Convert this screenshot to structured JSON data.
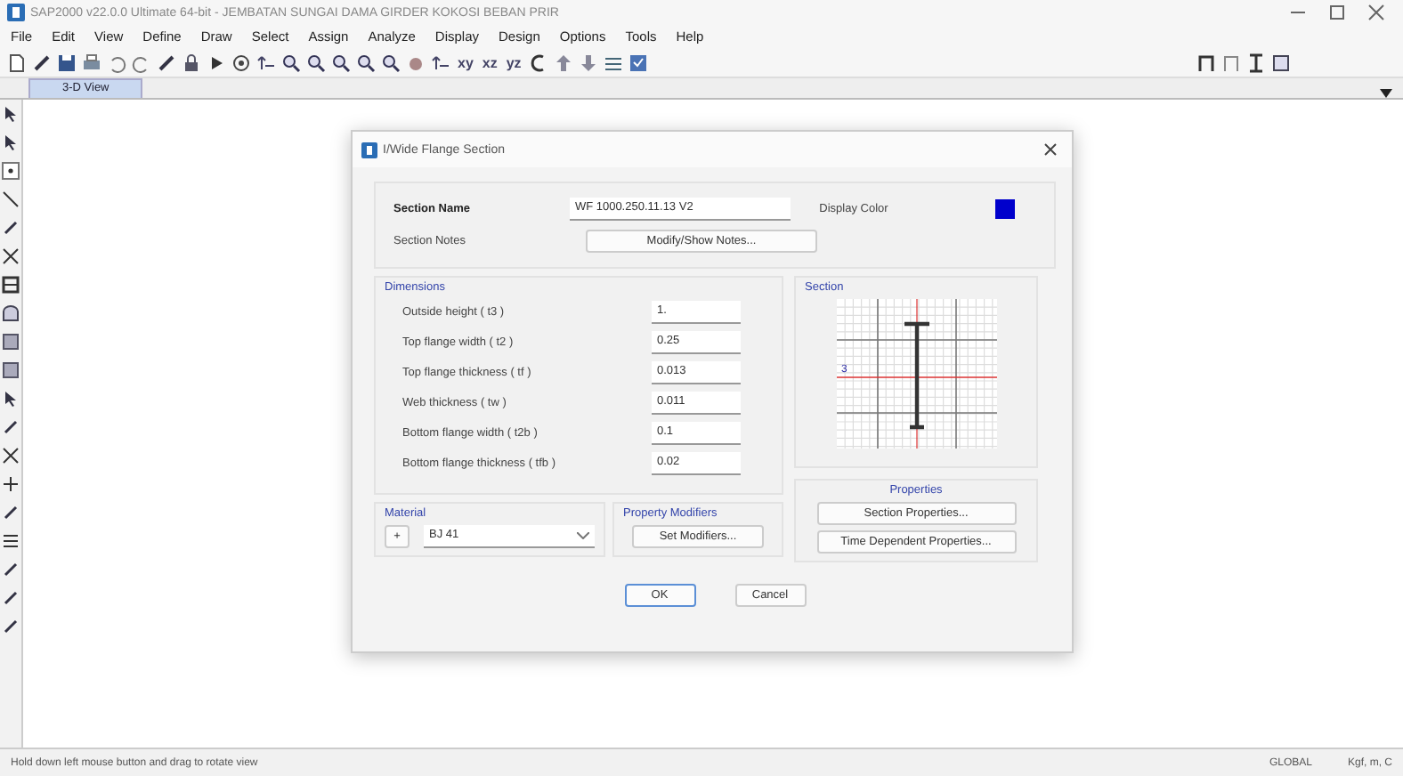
{
  "window": {
    "title": "SAP2000 v22.0.0 Ultimate 64-bit - JEMBATAN SUNGAI DAMA GIRDER KOKOSI BEBAN PRIR"
  },
  "menu": [
    "File",
    "Edit",
    "View",
    "Define",
    "Draw",
    "Select",
    "Assign",
    "Analyze",
    "Display",
    "Design",
    "Options",
    "Tools",
    "Help"
  ],
  "view_plane_buttons": [
    "xy",
    "xz",
    "yz"
  ],
  "tabs": [
    {
      "label": "3-D View",
      "selected": true
    }
  ],
  "dialog": {
    "title": "I/Wide Flange Section",
    "section_name_label": "Section Name",
    "section_name": "WF 1000.250.11.13 V2",
    "section_notes_label": "Section Notes",
    "notes_button": "Modify/Show Notes...",
    "display_color_label": "Display Color",
    "display_color_swatch": {
      "color": "#0000cc"
    },
    "dimensions": {
      "title": "Dimensions",
      "rows": [
        {
          "label": "Outside height  ( t3 )",
          "value": "1."
        },
        {
          "label": "Top flange width  ( t2 )",
          "value": "0.25"
        },
        {
          "label": "Top flange thickness  ( tf )",
          "value": "0.013"
        },
        {
          "label": "Web thickness  ( tw )",
          "value": "0.011"
        },
        {
          "label": "Bottom flange width  ( t2b )",
          "value": "0.1"
        },
        {
          "label": "Bottom flange thickness  ( tfb )",
          "value": "0.02"
        }
      ]
    },
    "section_title": "Section",
    "axis_label": "3",
    "properties": {
      "title": "Properties",
      "buttons": [
        "Section Properties...",
        "Time Dependent Properties..."
      ]
    },
    "material": {
      "title": "Material",
      "add_button": "+",
      "value": "BJ 41"
    },
    "property_modifiers": {
      "title": "Property Modifiers",
      "button": "Set Modifiers..."
    },
    "buttons": [
      "OK",
      "Cancel"
    ]
  },
  "status_bar": {
    "message": "Hold down left mouse button and drag to rotate view",
    "coordinate_system": "GLOBAL",
    "units": "Kgf, m, C"
  }
}
